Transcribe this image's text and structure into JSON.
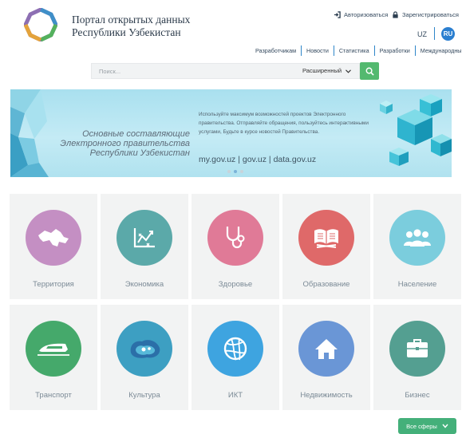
{
  "header": {
    "title_line1": "Портал открытых данных",
    "title_line2": "Республики Узбекистан",
    "login": "Авторизоваться",
    "register": "Зарегистрироваться",
    "lang_uz": "UZ",
    "lang_ru": "RU"
  },
  "topnav": [
    "Разработчикам",
    "Новости",
    "Статистика",
    "Разработки",
    "Международный опыт"
  ],
  "search": {
    "placeholder": "Поиск...",
    "advanced": "Расширенный"
  },
  "banner": {
    "main_line1": "Основные составляющие",
    "main_line2": "Электронного правительства",
    "main_line3": "Республики Узбекистан",
    "text": "Используйте максимум возможностей проектов Электронного правительства. Отправляйте обращения, пользуйтесь интерактивными услугами, Будьте в курсе новостей Правительства.",
    "links": "my.gov.uz | gov.uz | data.gov.uz"
  },
  "categories": [
    {
      "label": "Территория",
      "icon": "map-icon",
      "color": "#c48fc3"
    },
    {
      "label": "Экономика",
      "icon": "chart-icon",
      "color": "#5ba9a9"
    },
    {
      "label": "Здоровье",
      "icon": "stethoscope-icon",
      "color": "#e07a97"
    },
    {
      "label": "Образование",
      "icon": "book-icon",
      "color": "#df6969"
    },
    {
      "label": "Население",
      "icon": "people-icon",
      "color": "#7bcddd"
    },
    {
      "label": "Транспорт",
      "icon": "train-icon",
      "color": "#45a96b"
    },
    {
      "label": "Культура",
      "icon": "paisley-icon",
      "color": "#3d9fc2"
    },
    {
      "label": "ИКТ",
      "icon": "network-globe-icon",
      "color": "#3ea4e0"
    },
    {
      "label": "Недвижимость",
      "icon": "house-icon",
      "color": "#6a96d6"
    },
    {
      "label": "Бизнес",
      "icon": "briefcase-icon",
      "color": "#549f91"
    }
  ],
  "all_spheres": "Все сферы",
  "colors": {
    "accent_blue": "#2b7fd0",
    "accent_green": "#44b07a",
    "banner_bg": "#b8e6f2"
  }
}
